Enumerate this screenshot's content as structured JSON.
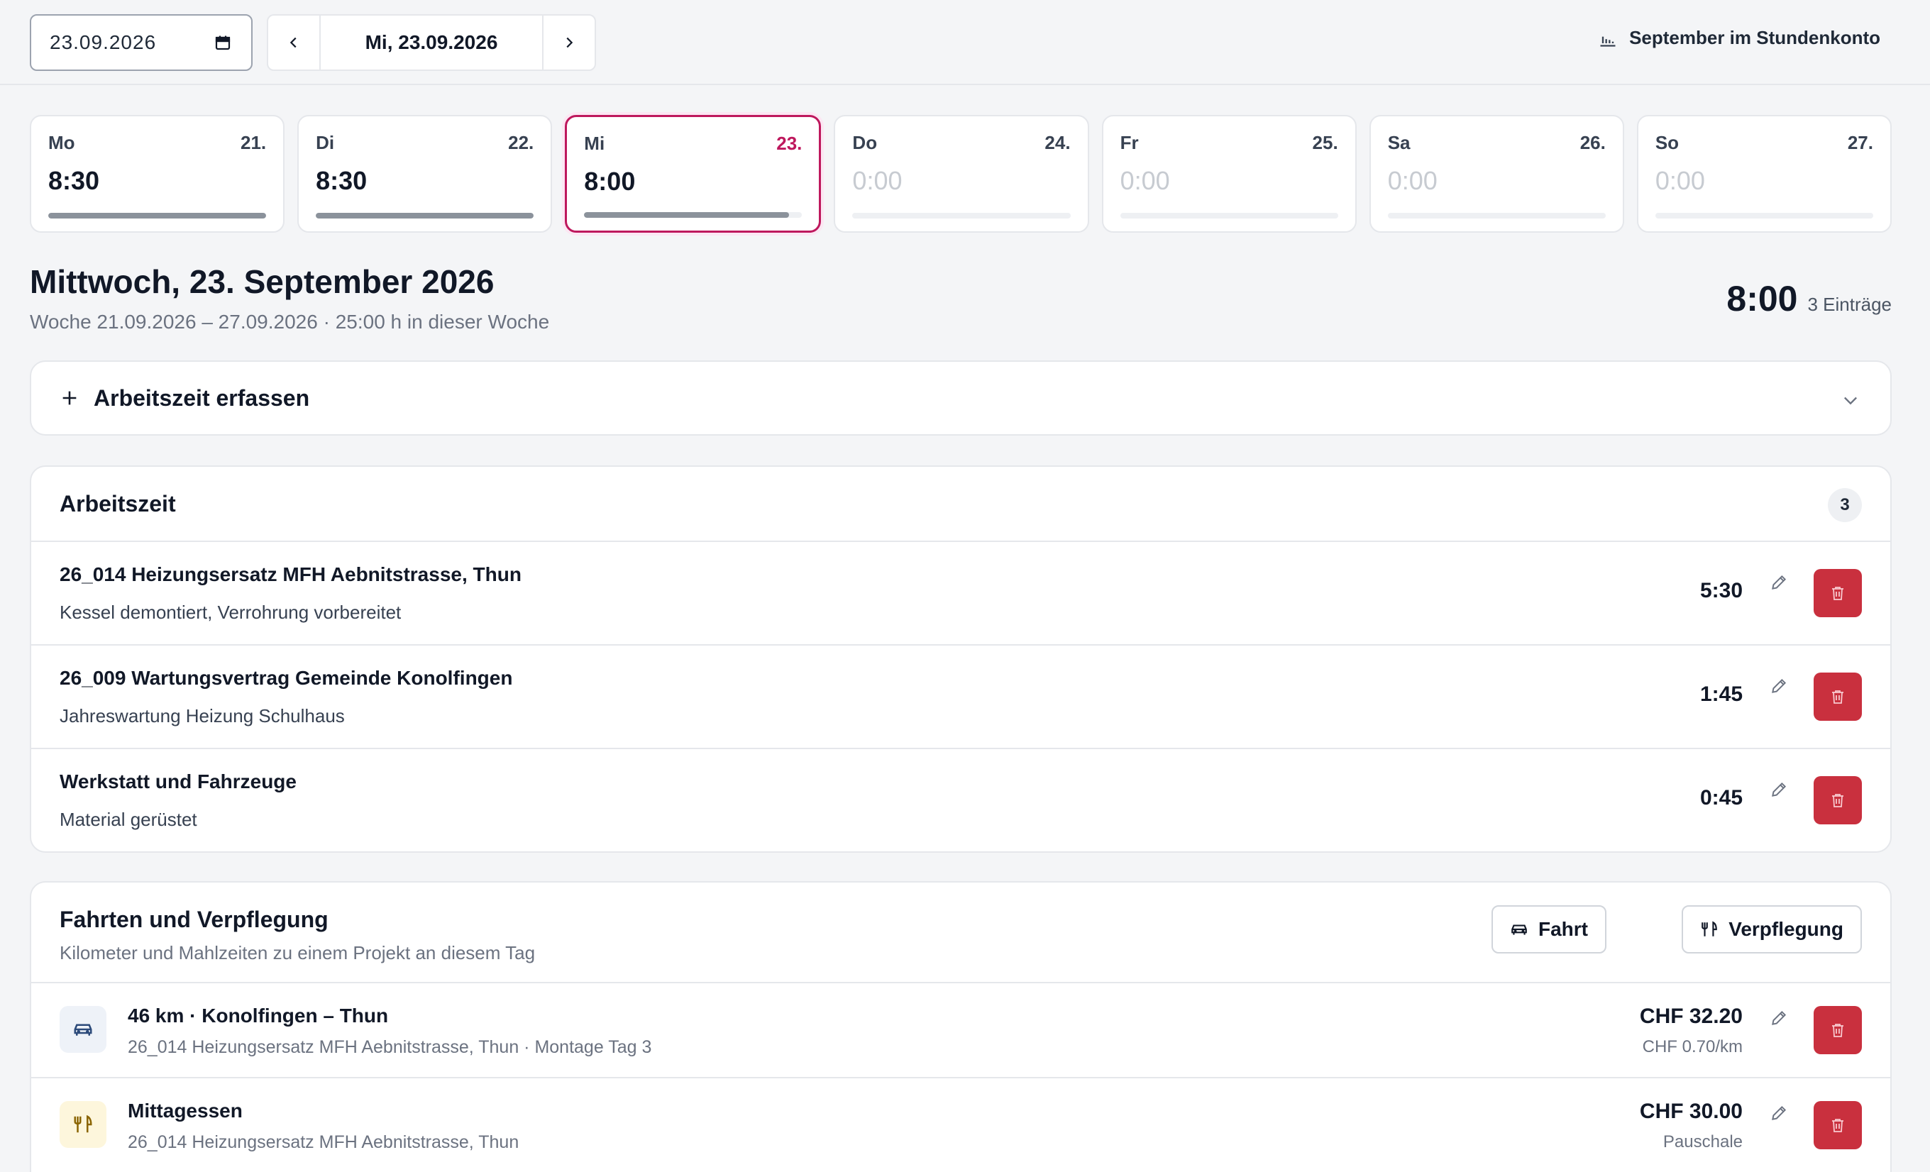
{
  "toolbar": {
    "date_value": "23.09.2026",
    "current_day": "Mi, 23.09.2026",
    "stundenkonto_label": "September im Stundenkonto"
  },
  "week": [
    {
      "weekday": "Mo",
      "date": "21.",
      "hours": "8:30",
      "progress": 1.0
    },
    {
      "weekday": "Di",
      "date": "22.",
      "hours": "8:30",
      "progress": 1.0
    },
    {
      "weekday": "Mi",
      "date": "23.",
      "hours": "8:00",
      "progress": 0.94,
      "selected": true
    },
    {
      "weekday": "Do",
      "date": "24.",
      "hours": "0:00",
      "progress": 0
    },
    {
      "weekday": "Fr",
      "date": "25.",
      "hours": "0:00",
      "progress": 0
    },
    {
      "weekday": "Sa",
      "date": "26.",
      "hours": "0:00",
      "progress": 0
    },
    {
      "weekday": "So",
      "date": "27.",
      "hours": "0:00",
      "progress": 0
    }
  ],
  "day_header": {
    "title": "Mittwoch, 23. September 2026",
    "subtitle": "Woche 21.09.2026 – 27.09.2026 · 25:00 h in dieser Woche",
    "total": "8:00",
    "entries": "3 Einträge"
  },
  "erfassen": {
    "label": "Arbeitszeit erfassen"
  },
  "arbeitszeit": {
    "title": "Arbeitszeit",
    "count": "3",
    "rows": [
      {
        "project": "26_014 Heizungsersatz MFH Aebnitstrasse, Thun",
        "description": "Kessel demontiert, Verrohrung vorbereitet",
        "duration": "5:30"
      },
      {
        "project": "26_009 Wartungsvertrag Gemeinde Konolfingen",
        "description": "Jahreswartung Heizung Schulhaus",
        "duration": "1:45"
      },
      {
        "project": "Werkstatt und Fahrzeuge",
        "description": "Material gerüstet",
        "duration": "0:45"
      }
    ]
  },
  "fahrten": {
    "title": "Fahrten und Verpflegung",
    "subtitle": "Kilometer und Mahlzeiten zu einem Projekt an diesem Tag",
    "btn_fahrt": "Fahrt",
    "btn_verpflegung": "Verpflegung",
    "rows": [
      {
        "title": "46 km · Konolfingen – Thun",
        "detail": "26_014 Heizungsersatz MFH Aebnitstrasse, Thun · Montage Tag 3",
        "amount": "CHF 32.20",
        "amount_sub": "CHF 0.70/km",
        "icon": "car-icon",
        "icon_bg": "#eef2f8"
      },
      {
        "title": "Mittagessen",
        "detail": "26_014 Heizungsersatz MFH Aebnitstrasse, Thun",
        "amount": "CHF 30.00",
        "amount_sub": "Pauschale",
        "icon": "utensils-icon",
        "icon_bg": "#fdf6dc"
      }
    ]
  },
  "colors": {
    "accent": "#be185d",
    "danger": "#c9303e",
    "progress": "#8b929b"
  }
}
